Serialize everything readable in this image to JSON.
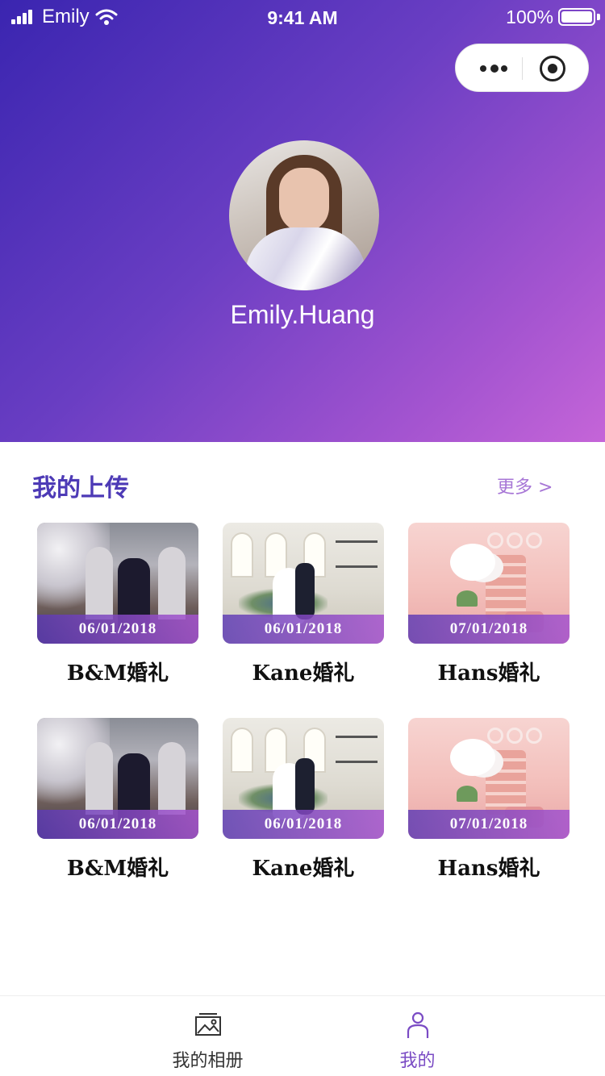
{
  "status_bar": {
    "carrier": "Emily",
    "time": "9:41 AM",
    "battery": "100%"
  },
  "colors": {
    "accent": "#4d3ab6",
    "more": "#a776d6",
    "gradient_start": "#3a25b0",
    "gradient_end": "#c565d8",
    "tab_active": "#7a4bc4",
    "tab_inactive": "#333333"
  },
  "capsule": {
    "icons": [
      "more-dots-icon",
      "close-target-icon"
    ]
  },
  "profile": {
    "username": "Emily.Huang"
  },
  "uploads": {
    "title": "我的上传",
    "more_label": "更多 >",
    "items": [
      {
        "date": "06/01/2018",
        "name": "B&M婚礼",
        "scene": "chapel-couple"
      },
      {
        "date": "06/01/2018",
        "name": "Kane婚礼",
        "scene": "studio-couple"
      },
      {
        "date": "07/01/2018",
        "name": "Hans婚礼",
        "scene": "pink-still-life"
      },
      {
        "date": "06/01/2018",
        "name": "B&M婚礼",
        "scene": "chapel-couple"
      },
      {
        "date": "06/01/2018",
        "name": "Kane婚礼",
        "scene": "studio-couple"
      },
      {
        "date": "07/01/2018",
        "name": "Hans婚礼",
        "scene": "pink-still-life"
      }
    ]
  },
  "tabbar": {
    "tabs": [
      {
        "label": "我的相册",
        "icon": "photo-album-icon",
        "active": false
      },
      {
        "label": "我的",
        "icon": "profile-icon",
        "active": true
      }
    ]
  }
}
